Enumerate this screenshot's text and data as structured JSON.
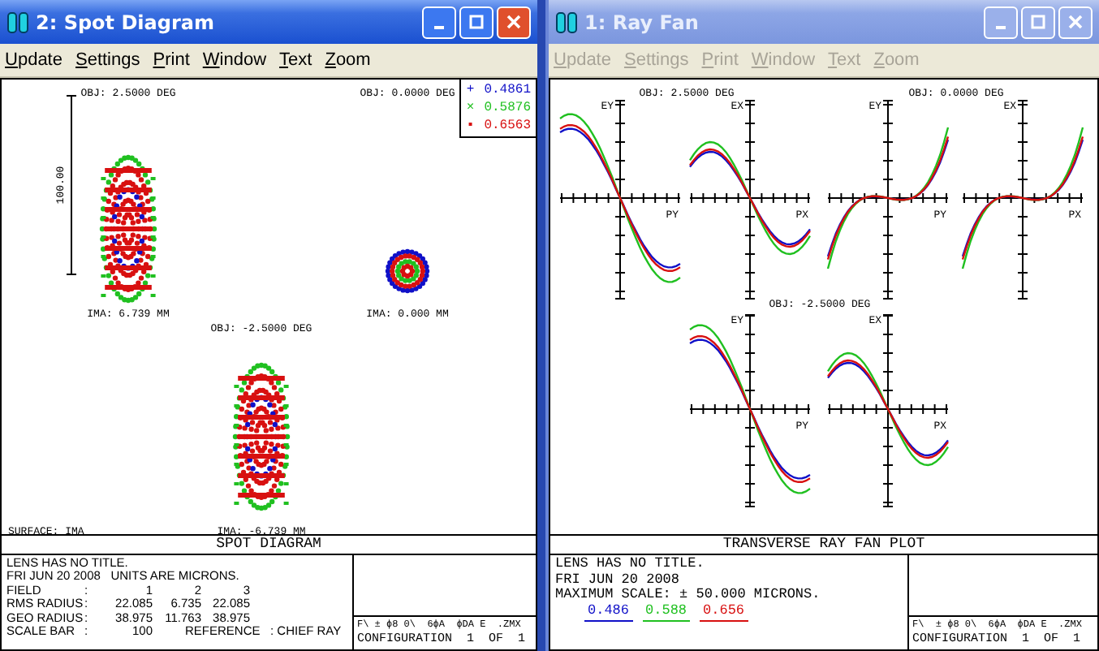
{
  "windows": [
    {
      "kind": "spot",
      "title": "2: Spot Diagram",
      "active": true,
      "menu": [
        {
          "label": "Update",
          "disabled": false
        },
        {
          "label": "Settings",
          "disabled": false
        },
        {
          "label": "Print",
          "disabled": false
        },
        {
          "label": "Window",
          "disabled": false
        },
        {
          "label": "Text",
          "disabled": false
        },
        {
          "label": "Zoom",
          "disabled": false
        }
      ],
      "spots": [
        {
          "field": "OBJ: 2.5000 DEG",
          "image": "IMA: 6.739 MM",
          "kind": "ellipse"
        },
        {
          "field": "OBJ: 0.0000 DEG",
          "image": "IMA: 0.000 MM",
          "kind": "round"
        },
        {
          "field": "OBJ: -2.5000 DEG",
          "image": "IMA: -6.739 MM",
          "kind": "ellipse"
        }
      ],
      "scale_label": "100.00",
      "legend": [
        {
          "mark": "+",
          "label": "0.4861",
          "color": "#1010c8"
        },
        {
          "mark": "×",
          "label": "0.5876",
          "color": "#20c020"
        },
        {
          "mark": "▪",
          "label": "0.6563",
          "color": "#d81010"
        }
      ],
      "surface": "SURFACE: IMA",
      "caption": "SPOT DIAGRAM",
      "info_lines": [
        "LENS HAS NO TITLE.",
        "FRI JUN 20 2008   UNITS ARE MICRONS."
      ],
      "info_table": [
        [
          "FIELD",
          ":",
          "1",
          "2",
          "3"
        ],
        [
          "RMS RADIUS",
          ":",
          "22.085",
          "6.735",
          "22.085"
        ],
        [
          "GEO RADIUS",
          ":",
          "38.975",
          "11.763",
          "38.975"
        ],
        [
          "SCALE BAR",
          ":",
          "100"
        ]
      ],
      "reference": "REFERENCE   : CHIEF RAY",
      "file": "F\\ ± ϕ8 0\\  6ϕA  ϕDA E  .ZMX",
      "configuration": "CONFIGURATION  1  OF  1"
    },
    {
      "kind": "fan",
      "title": "1: Ray Fan",
      "active": false,
      "menu": [
        {
          "label": "Update",
          "disabled": true
        },
        {
          "label": "Settings",
          "disabled": true
        },
        {
          "label": "Print",
          "disabled": true
        },
        {
          "label": "Window",
          "disabled": true
        },
        {
          "label": "Text",
          "disabled": true
        },
        {
          "label": "Zoom",
          "disabled": true
        }
      ],
      "fans": [
        {
          "field": "OBJ: 2.5000 DEG",
          "plots": [
            {
              "y_axis": "EY",
              "x_axis": "PY",
              "kind": "tangential"
            },
            {
              "y_axis": "EX",
              "x_axis": "PX",
              "kind": "sagittal"
            }
          ]
        },
        {
          "field": "OBJ: 0.0000 DEG",
          "plots": [
            {
              "y_axis": "EY",
              "x_axis": "PY",
              "kind": "cubic"
            },
            {
              "y_axis": "EX",
              "x_axis": "PX",
              "kind": "cubic"
            }
          ]
        },
        {
          "field": "OBJ: -2.5000 DEG",
          "plots": [
            {
              "y_axis": "EY",
              "x_axis": "PY",
              "kind": "tangential"
            },
            {
              "y_axis": "EX",
              "x_axis": "PX",
              "kind": "sagittal"
            }
          ]
        }
      ],
      "caption": "TRANSVERSE RAY FAN PLOT",
      "info_lines": [
        "LENS HAS NO TITLE.",
        "FRI JUN 20 2008",
        "MAXIMUM SCALE: ± 50.000 MICRONS."
      ],
      "wavelengths": [
        {
          "label": "0.486",
          "color": "#1010c8"
        },
        {
          "label": "0.588",
          "color": "#20c020"
        },
        {
          "label": "0.656",
          "color": "#d81010"
        }
      ],
      "file": "F\\  ± ϕ8 0\\  6ϕA  ϕDA E  .ZMX",
      "configuration": "CONFIGURATION  1  OF  1"
    }
  ]
}
